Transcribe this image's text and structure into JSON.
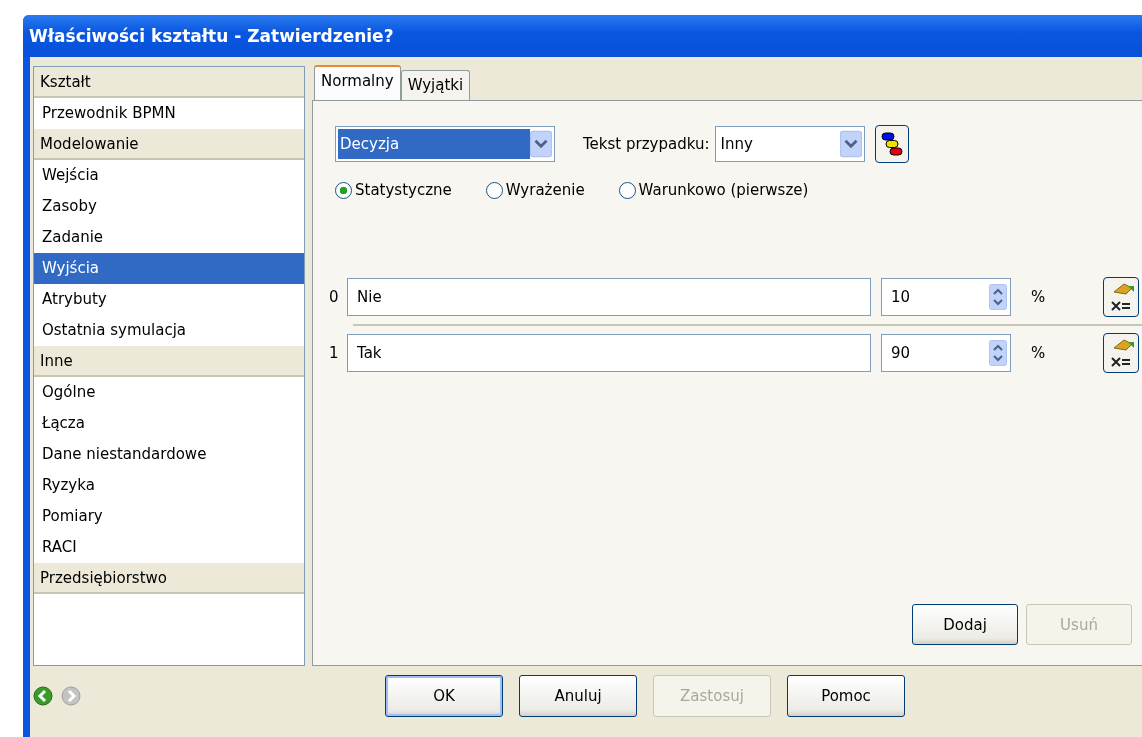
{
  "window": {
    "title": "Właściwości kształtu - Zatwierdzenie?"
  },
  "sidebar": {
    "items": [
      {
        "kind": "group",
        "label": "Kształt",
        "selected": false
      },
      {
        "kind": "item",
        "label": "Przewodnik BPMN",
        "selected": false
      },
      {
        "kind": "group",
        "label": "Modelowanie",
        "selected": false
      },
      {
        "kind": "item",
        "label": "Wejścia",
        "selected": false
      },
      {
        "kind": "item",
        "label": "Zasoby",
        "selected": false
      },
      {
        "kind": "item",
        "label": "Zadanie",
        "selected": false
      },
      {
        "kind": "item",
        "label": "Wyjścia",
        "selected": true
      },
      {
        "kind": "item",
        "label": "Atrybuty",
        "selected": false
      },
      {
        "kind": "item",
        "label": "Ostatnia symulacja",
        "selected": false
      },
      {
        "kind": "group",
        "label": "Inne",
        "selected": false
      },
      {
        "kind": "item",
        "label": "Ogólne",
        "selected": false
      },
      {
        "kind": "item",
        "label": "Łącza",
        "selected": false
      },
      {
        "kind": "item",
        "label": "Dane niestandardowe",
        "selected": false
      },
      {
        "kind": "item",
        "label": "Ryzyka",
        "selected": false
      },
      {
        "kind": "item",
        "label": "Pomiary",
        "selected": false
      },
      {
        "kind": "item",
        "label": "RACI",
        "selected": false
      },
      {
        "kind": "group",
        "label": "Przedsiębiorstwo",
        "selected": false
      }
    ]
  },
  "tabs": [
    {
      "label": "Normalny",
      "selected": true
    },
    {
      "label": "Wyjątki",
      "selected": false
    }
  ],
  "type_dropdown": {
    "value": "Decyzja",
    "focused": true
  },
  "case_text": {
    "label": "Tekst przypadku:",
    "value": "Inny"
  },
  "distribution": [
    {
      "label": "Statystyczne",
      "selected": true
    },
    {
      "label": "Wyrażenie",
      "selected": false
    },
    {
      "label": "Warunkowo (pierwsze)",
      "selected": false
    }
  ],
  "outputs": [
    {
      "index": "0",
      "name": "Nie",
      "value": "10",
      "unit": "%"
    },
    {
      "index": "1",
      "name": "Tak",
      "value": "90",
      "unit": "%"
    }
  ],
  "panel_buttons": [
    {
      "label": "Dodaj",
      "disabled": false
    },
    {
      "label": "Usuń",
      "disabled": true
    }
  ],
  "dialog_buttons": [
    {
      "label": "OK",
      "disabled": false,
      "default": true
    },
    {
      "label": "Anuluj",
      "disabled": false,
      "default": false
    },
    {
      "label": "Zastosuj",
      "disabled": true,
      "default": false
    },
    {
      "label": "Pomoc",
      "disabled": false,
      "default": false
    }
  ]
}
